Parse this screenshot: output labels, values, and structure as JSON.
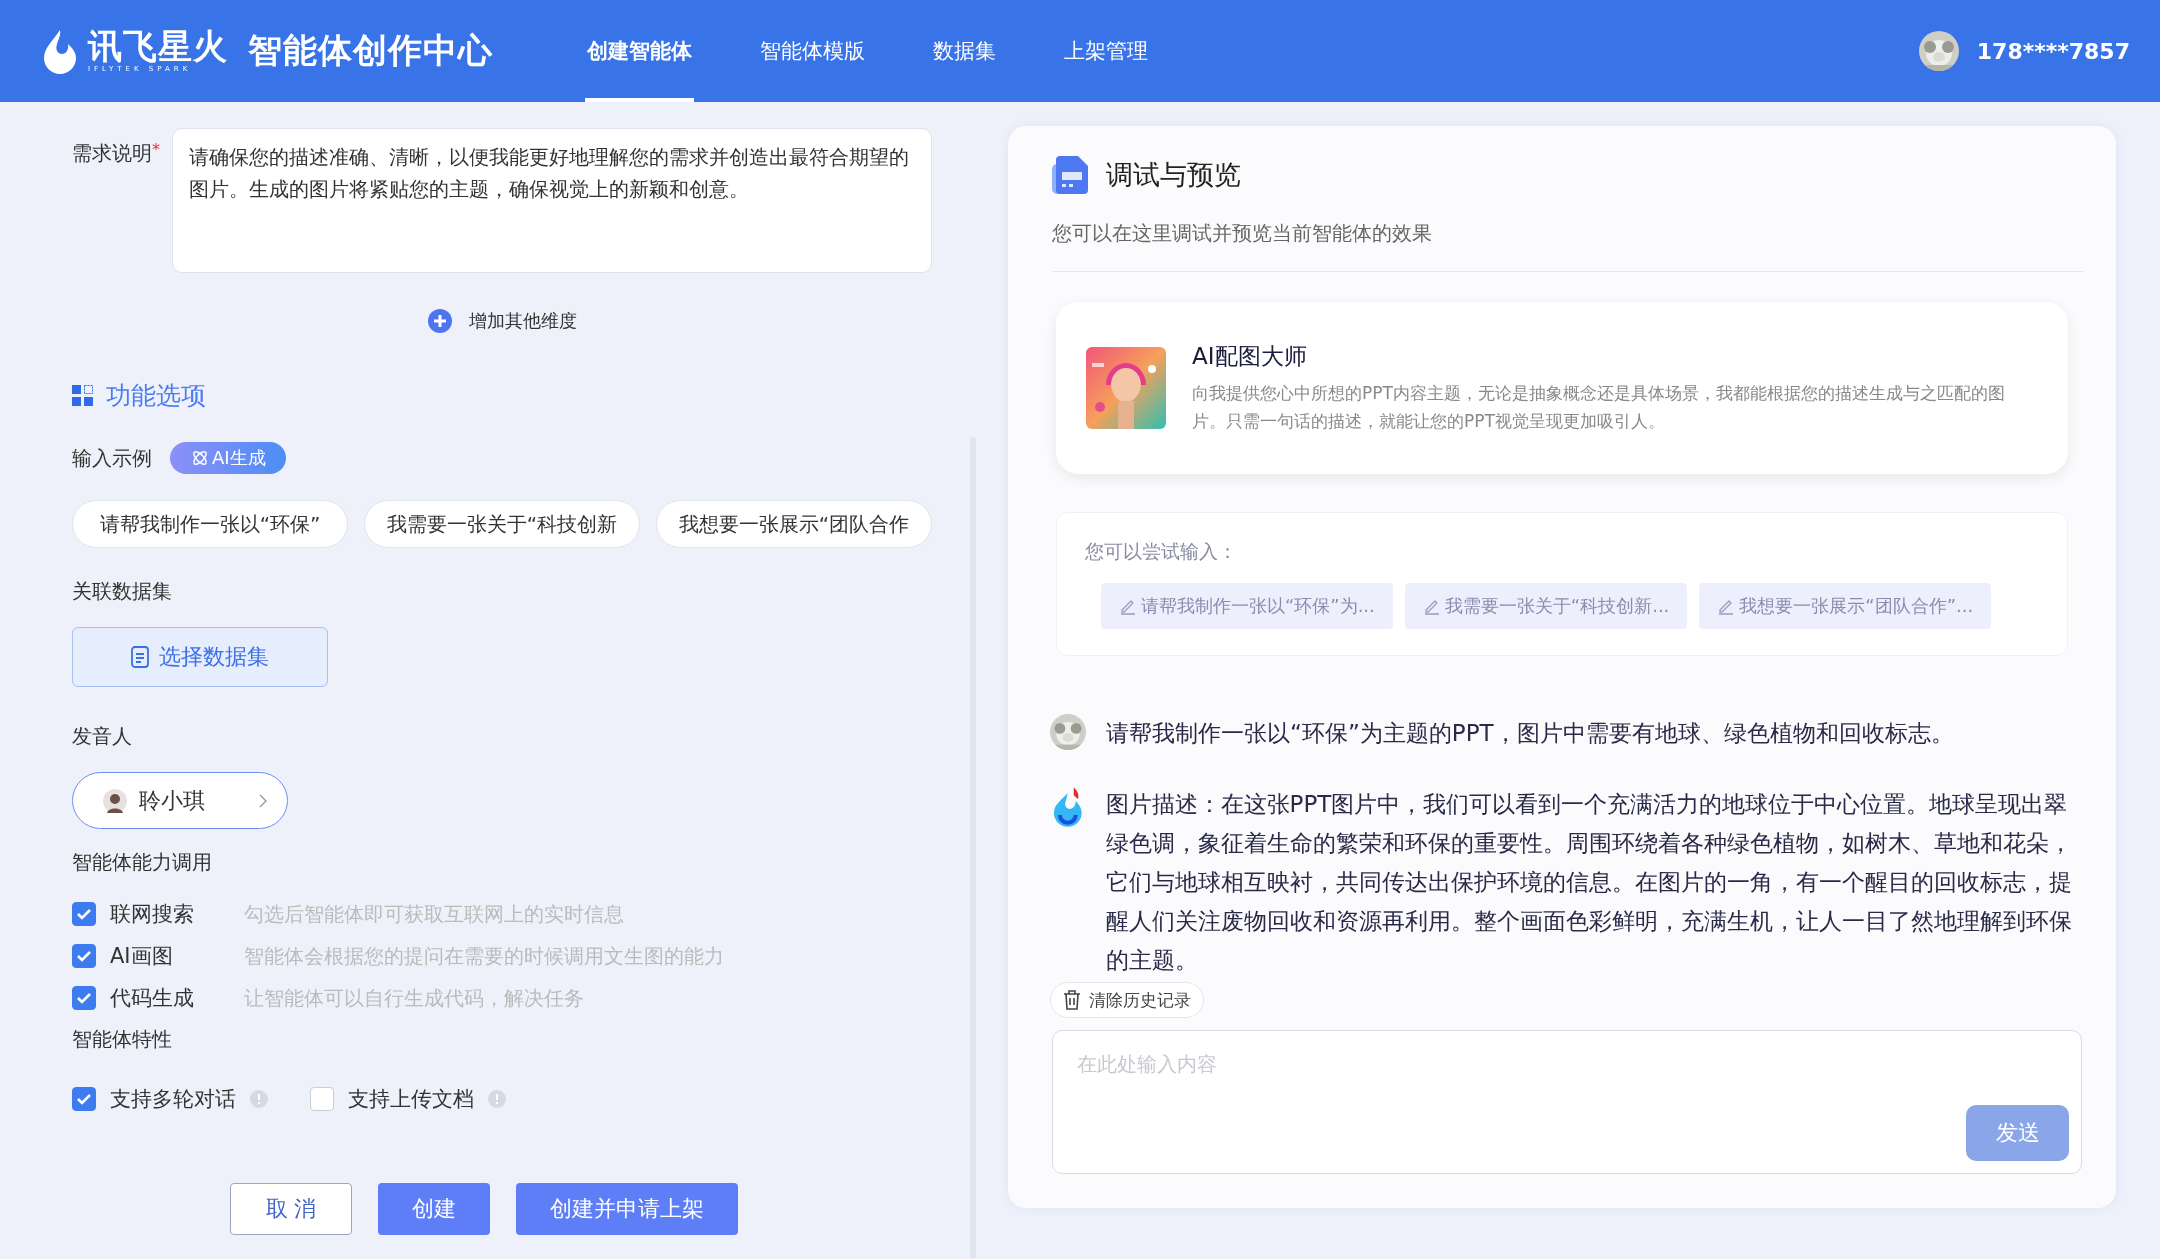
{
  "header": {
    "logo_text": "讯飞星火",
    "logo_subtext": "IFLYTEK SPARK",
    "title": "智能体创作中心",
    "nav": [
      {
        "label": "创建智能体",
        "selected": true
      },
      {
        "label": "智能体模版",
        "selected": false
      },
      {
        "label": "数据集",
        "selected": false
      },
      {
        "label": "上架管理",
        "selected": false
      }
    ],
    "user": "178****7857"
  },
  "form": {
    "requirement": {
      "label": "需求说明",
      "required_mark": "*",
      "value": "请确保您的描述准确、清晰，以便我能更好地理解您的需求并创造出最符合期望的图片。生成的图片将紧贴您的主题，确保视觉上的新颖和创意。"
    },
    "add_dimension": "增加其他维度",
    "section_title": "功能选项",
    "examples": {
      "label": "输入示例",
      "badge": "AI生成",
      "chips": [
        "请帮我制作一张以“环保”",
        "我需要一张关于“科技创新",
        "我想要一张展示“团队合作"
      ]
    },
    "dataset": {
      "label": "关联数据集",
      "button": "选择数据集"
    },
    "speaker": {
      "label": "发音人",
      "name": "聆小琪"
    },
    "capabilities": {
      "label": "智能体能力调用",
      "items": [
        {
          "name": "联网搜索",
          "description": "勾选后智能体即可获取互联网上的实时信息",
          "checked": true
        },
        {
          "name": "AI画图",
          "description": "智能体会根据您的提问在需要的时候调用文生图的能力",
          "checked": true
        },
        {
          "name": "代码生成",
          "description": "让智能体可以自行生成代码，解决任务",
          "checked": true
        }
      ]
    },
    "features": {
      "label": "智能体特性",
      "items": [
        {
          "name": "支持多轮对话",
          "checked": true
        },
        {
          "name": "支持上传文档",
          "checked": false
        }
      ]
    },
    "buttons": [
      {
        "label": "取 消",
        "kind": "outline"
      },
      {
        "label": "创建",
        "kind": "primary"
      },
      {
        "label": "创建并申请上架",
        "kind": "primary"
      }
    ]
  },
  "preview": {
    "title": "调试与预览",
    "subtitle": "您可以在这里调试并预览当前智能体的效果",
    "agent": {
      "name": "AI配图大师",
      "description": "向我提供您心中所想的PPT内容主题，无论是抽象概念还是具体场景，我都能根据您的描述生成与之匹配的图片。只需一句话的描述，就能让您的PPT视觉呈现更加吸引人。"
    },
    "suggestions": {
      "label": "您可以尝试输入：",
      "items": [
        "请帮我制作一张以“环保”为...",
        "我需要一张关于“科技创新...",
        "我想要一张展示“团队合作”..."
      ]
    },
    "messages": [
      {
        "kind": "user",
        "text": "请帮我制作一张以“环保”为主题的PPT，图片中需要有地球、绿色植物和回收标志。"
      },
      {
        "kind": "bot",
        "text": "图片描述：在这张PPT图片中，我们可以看到一个充满活力的地球位于中心位置。地球呈现出翠绿色调，象征着生命的繁荣和环保的重要性。周围环绕着各种绿色植物，如树木、草地和花朵，它们与地球相互映衬，共同传达出保护环境的信息。在图片的一角，有一个醒目的回收标志，提醒人们关注废物回收和资源再利用。整个画面色彩鲜明，充满生机，让人一目了然地理解到环保的主题。"
      }
    ],
    "clear_history": "清除历史记录",
    "input": {
      "placeholder": "在此处输入内容"
    },
    "send": "发送"
  }
}
